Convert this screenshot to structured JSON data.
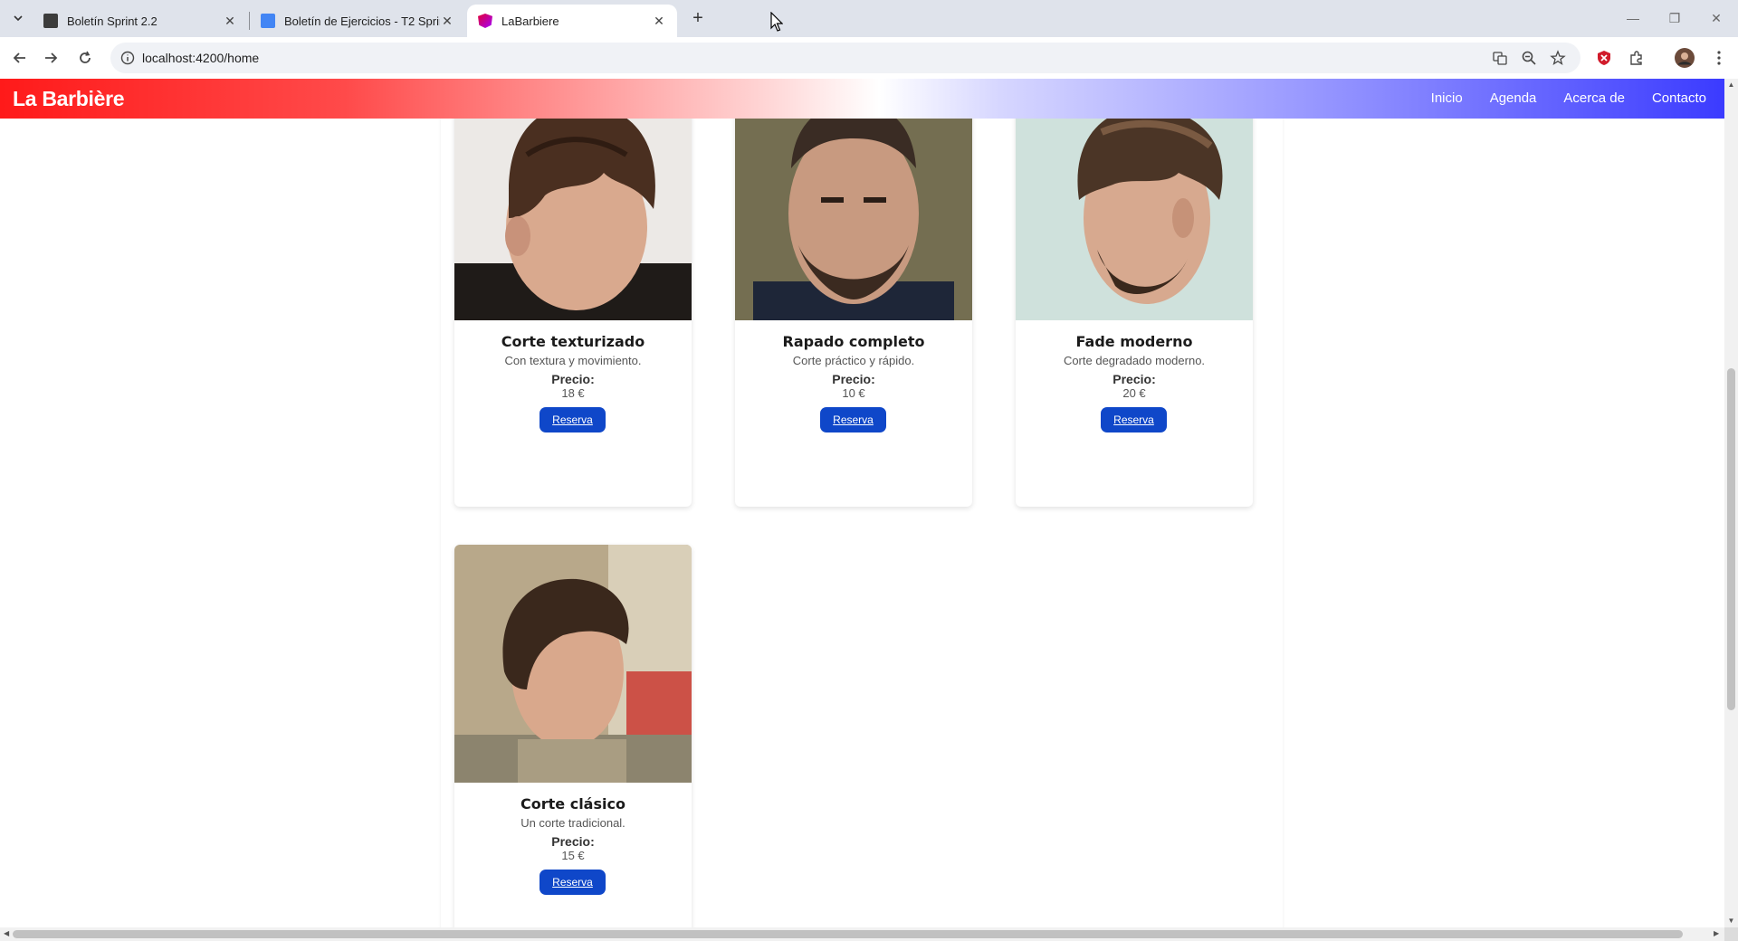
{
  "browser": {
    "tabs": [
      {
        "title": "Boletín Sprint 2.2",
        "icon": "doc-person-icon"
      },
      {
        "title": "Boletín de Ejercicios - T2 Sprint",
        "icon": "google-docs-icon"
      },
      {
        "title": "LaBarbiere",
        "icon": "angular-icon",
        "active": true
      }
    ],
    "url": "localhost:4200/home"
  },
  "site": {
    "brand": "La Barbière",
    "nav": [
      "Inicio",
      "Agenda",
      "Acerca de",
      "Contacto"
    ]
  },
  "services": [
    {
      "name": "Corte texturizado",
      "description": "Con textura y movimiento.",
      "price_label": "Precio:",
      "price": "18 €",
      "button": "Reserva"
    },
    {
      "name": "Rapado completo",
      "description": "Corte práctico y rápido.",
      "price_label": "Precio:",
      "price": "10 €",
      "button": "Reserva"
    },
    {
      "name": "Fade moderno",
      "description": "Corte degradado moderno.",
      "price_label": "Precio:",
      "price": "20 €",
      "button": "Reserva"
    },
    {
      "name": "Corte clásico",
      "description": "Un corte tradicional.",
      "price_label": "Precio:",
      "price": "15 €",
      "button": "Reserva"
    }
  ],
  "colors": {
    "brand_red": "#ff1a1a",
    "brand_blue": "#3b3bff",
    "button_blue": "#0f47c9"
  }
}
